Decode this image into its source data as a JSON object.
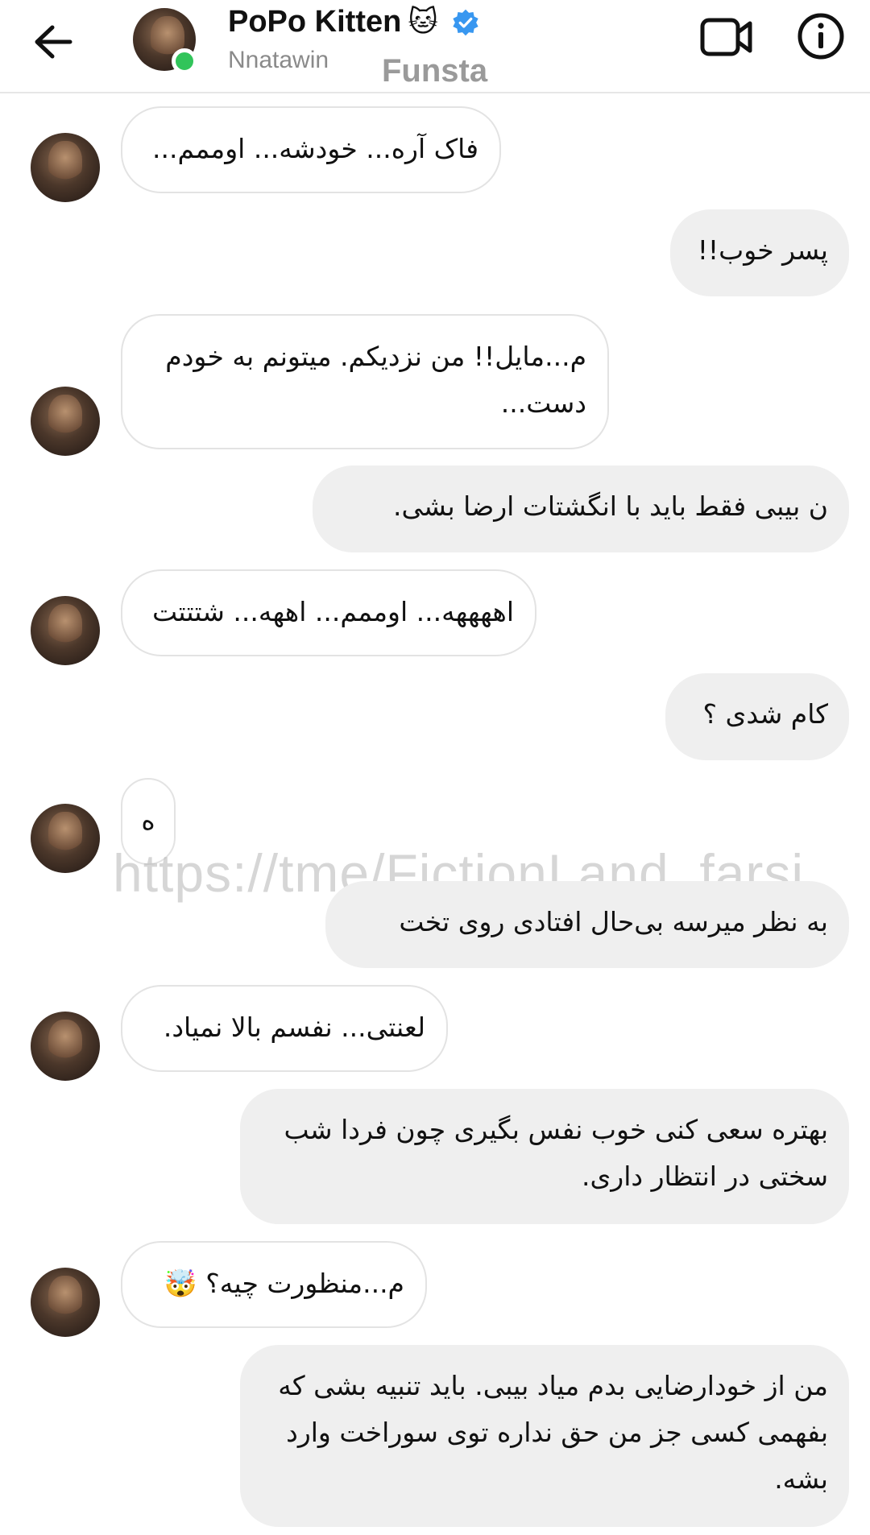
{
  "header": {
    "title": "PoPo Kitten",
    "title_emoji": "🐱",
    "subtitle": "Nnatawin",
    "watermark": "Funsta",
    "accent_color": "#3897f0",
    "online_color": "#31c45a"
  },
  "watermark_link": "https://tme/FictionLand_farsi",
  "messages": [
    {
      "from": "them",
      "text": "فاک آره... خودشه... اوممم..."
    },
    {
      "from": "me",
      "text": "پسر خوب!!"
    },
    {
      "from": "them",
      "text": "م...مایل!! من نزدیکم. میتونم به خودم دست..."
    },
    {
      "from": "me",
      "text": "ن بیبی فقط باید با انگشتات ارضا بشی."
    },
    {
      "from": "them",
      "text": "اههههه... اوممم... اههه... شتتتت"
    },
    {
      "from": "me",
      "text": "کام شدی ؟"
    },
    {
      "from": "them",
      "text": "ه"
    },
    {
      "from": "me",
      "text": "به نظر میرسه بی‌حال افتادی روی تخت"
    },
    {
      "from": "them",
      "text": "لعنتی... نفسم بالا نمیاد."
    },
    {
      "from": "me",
      "text": "بهتره سعی کنی خوب نفس بگیری چون فردا شب سختی در انتظار داری."
    },
    {
      "from": "them",
      "text": "م...منظورت چیه؟ 🤯"
    },
    {
      "from": "me",
      "text": "من از خودارضایی بدم میاد بیبی. باید تنبیه بشی که بفهمی کسی جز من حق نداره توی سوراخت وارد بشه."
    }
  ]
}
